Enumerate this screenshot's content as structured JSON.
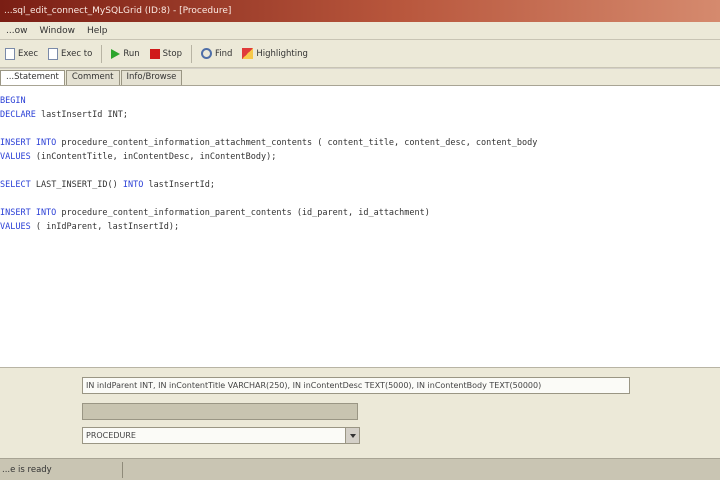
{
  "window": {
    "title": "...sql_edit_connect_MySQLGrid (ID:8) - [Procedure]"
  },
  "menu": [
    "...ow",
    "Window",
    "Help"
  ],
  "toolbar": {
    "buttons": [
      {
        "label": "Exec"
      },
      {
        "label": "Exec to"
      },
      {
        "label": "Run"
      },
      {
        "label": "Stop"
      },
      {
        "label": "Find"
      },
      {
        "label": "Highlighting"
      }
    ]
  },
  "tabs": [
    "...Statement",
    "Comment",
    "Info/Browse"
  ],
  "editor": {
    "lines": [
      [
        {
          "t": "BEGIN",
          "k": true
        }
      ],
      [
        {
          "t": "DECLARE",
          "k": true
        },
        {
          "t": " lastInsertId INT;",
          "k": false
        }
      ],
      [
        {
          "t": "",
          "k": false
        }
      ],
      [
        {
          "t": "INSERT INTO",
          "k": true
        },
        {
          "t": " procedure_content_information_attachment_contents ( content_title, content_desc, content_body",
          "k": false
        }
      ],
      [
        {
          "t": "VALUES",
          "k": true
        },
        {
          "t": " (inContentTitle, inContentDesc, inContentBody);",
          "k": false
        }
      ],
      [
        {
          "t": "",
          "k": false
        }
      ],
      [
        {
          "t": "SELECT",
          "k": true
        },
        {
          "t": " LAST_INSERT_ID() ",
          "k": false
        },
        {
          "t": "INTO",
          "k": true
        },
        {
          "t": " lastInsertId;",
          "k": false
        }
      ],
      [
        {
          "t": "",
          "k": false
        }
      ],
      [
        {
          "t": "INSERT INTO",
          "k": true
        },
        {
          "t": " procedure_content_information_parent_contents (id_parent, id_attachment)",
          "k": false
        }
      ],
      [
        {
          "t": "VALUES",
          "k": true
        },
        {
          "t": " ( inIdParent, lastInsertId);",
          "k": false
        }
      ]
    ]
  },
  "lower": {
    "params_value": "IN inIdParent INT, IN inContentTitle VARCHAR(250), IN inContentDesc TEXT(5000), IN inContentBody TEXT(50000)",
    "returns_value": "",
    "type_value": "PROCEDURE"
  },
  "status": {
    "text": "...e is ready"
  }
}
